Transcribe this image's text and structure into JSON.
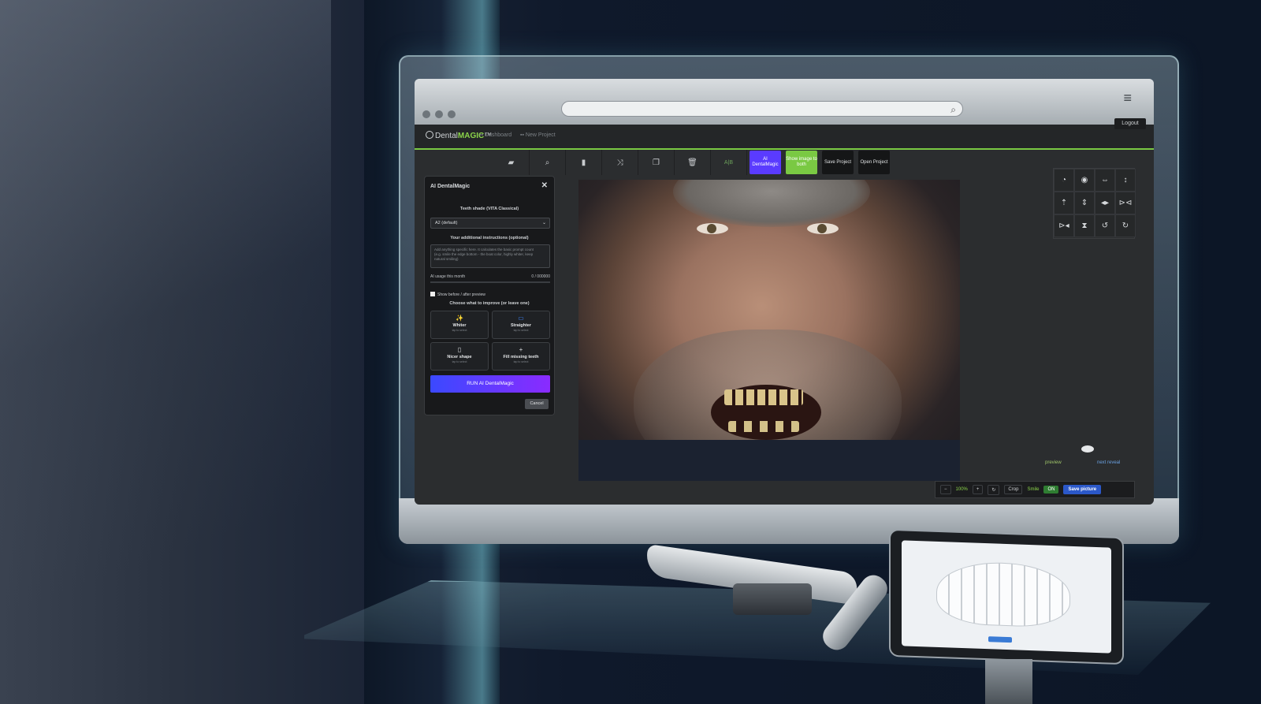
{
  "browser": {
    "menu_icon": "hamburger-icon",
    "search_icon": "magnifier-icon"
  },
  "app": {
    "logo_prefix": "Dental",
    "logo_suffix": "MAGIC",
    "logo_tm": "™",
    "nav": [
      {
        "label": "Dashboard"
      },
      {
        "label": "New Project"
      }
    ],
    "logout_label": "Logout",
    "accent_color": "#7ac943"
  },
  "toolbar": {
    "icon_buttons": [
      {
        "name": "folder-icon",
        "glyph": "▰"
      },
      {
        "name": "lasso-icon",
        "glyph": "⌕"
      },
      {
        "name": "file-icon",
        "glyph": "▮"
      },
      {
        "name": "shuffle-icon",
        "glyph": "⤨"
      },
      {
        "name": "copy-icon",
        "glyph": "❐"
      },
      {
        "name": "trash-icon",
        "glyph": "🗑"
      }
    ],
    "ab_label": "A|B",
    "ai_label": "AI DentalMagic",
    "ai_color": "#5a3bff",
    "show_image_label": "Show image to both",
    "show_image_color": "#7ac943",
    "save_project_label": "Save Project",
    "open_project_label": "Open Project"
  },
  "ai_panel": {
    "title": "AI DentalMagic",
    "close_glyph": "✕",
    "shade_label": "Teeth shade (VITA Classical)",
    "shade_value": "A2 (default)",
    "instructions_label": "Your additional instructions (optional)",
    "instructions_placeholder": "Add anything specific here. It calculates the basic prompt count (e.g. smile the edge bottom - the boat color, highly whiter, keep natural smiling)",
    "usage_label": "AI usage this month",
    "usage_value": "0 / 000000",
    "show_preview_label": "Show before / after preview",
    "improve_label": "Choose what to improve (or leave one)",
    "options": [
      {
        "icon": "✨",
        "title": "Whiter",
        "hint": "tap to select"
      },
      {
        "icon": "▭",
        "title": "Straighter",
        "hint": "tap to select"
      },
      {
        "icon": "▯",
        "title": "Nicer shape",
        "hint": "tap to select"
      },
      {
        "icon": "+",
        "title": "Fill missing teeth",
        "hint": "tap to select"
      }
    ],
    "run_label": "RUN AI DentalMagic",
    "cancel_label": "Cancel"
  },
  "tools": [
    {
      "name": "visibility-icon",
      "glyph": "◔"
    },
    {
      "name": "eye-icon",
      "glyph": "◉"
    },
    {
      "name": "flip-horizontal-icon",
      "glyph": "⇔"
    },
    {
      "name": "move-vertical-icon",
      "glyph": "↕"
    },
    {
      "name": "align-top-icon",
      "glyph": "⇡"
    },
    {
      "name": "align-center-icon",
      "glyph": "⇕"
    },
    {
      "name": "expand-horizontal-icon",
      "glyph": "◂▸"
    },
    {
      "name": "mirror-icon",
      "glyph": "⊳⊲"
    },
    {
      "name": "flip-left-icon",
      "glyph": "⊳◂"
    },
    {
      "name": "flip-vertical-icon",
      "glyph": "⧗"
    },
    {
      "name": "rotate-left-icon",
      "glyph": "↺"
    },
    {
      "name": "rotate-right-icon",
      "glyph": "↻"
    }
  ],
  "side_labels": {
    "left": "preview",
    "right": "next reveal"
  },
  "bottom_bar": {
    "minus": "−",
    "zoom": "100%",
    "plus": "+",
    "refresh_icon": "↻",
    "crop_label": "Crop",
    "smile_label": "Smile",
    "toggle_label": "ON",
    "save_label": "Save picture"
  }
}
